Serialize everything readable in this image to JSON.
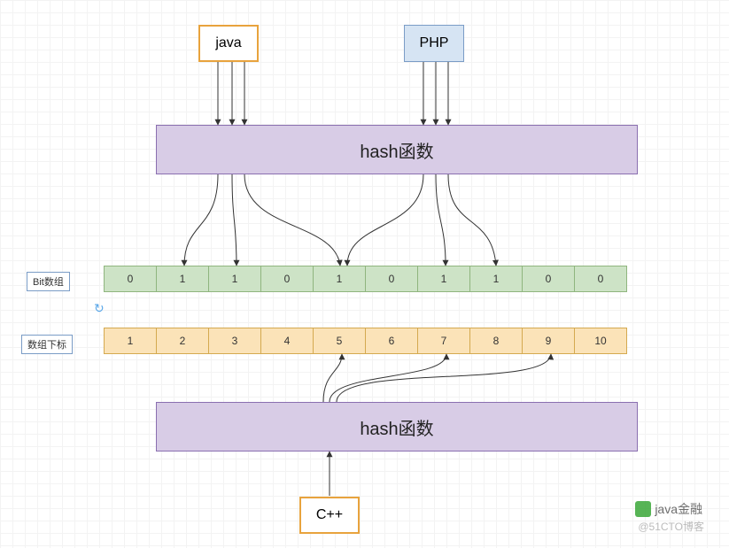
{
  "nodes": {
    "java": "java",
    "php": "PHP",
    "hash1": "hash函数",
    "hash2": "hash函数",
    "cpp": "C++"
  },
  "labels": {
    "bitArray": "Bit数组",
    "indexArray": "数组下标"
  },
  "bitArray": [
    "0",
    "1",
    "1",
    "0",
    "1",
    "0",
    "1",
    "1",
    "0",
    "0"
  ],
  "indexArray": [
    "1",
    "2",
    "3",
    "4",
    "5",
    "6",
    "7",
    "8",
    "9",
    "10"
  ],
  "watermark": {
    "line1": "java金融",
    "line2": "@51CTO博客"
  },
  "chart_data": {
    "type": "table",
    "title": "Bloom filter bit array illustration",
    "series": [
      {
        "name": "Bit数组",
        "values": [
          0,
          1,
          1,
          0,
          1,
          0,
          1,
          1,
          0,
          0
        ]
      },
      {
        "name": "数组下标",
        "values": [
          1,
          2,
          3,
          4,
          5,
          6,
          7,
          8,
          9,
          10
        ]
      }
    ],
    "inputs_top": [
      "java",
      "PHP"
    ],
    "inputs_bottom": [
      "C++"
    ],
    "hash_box_label": "hash函数"
  }
}
